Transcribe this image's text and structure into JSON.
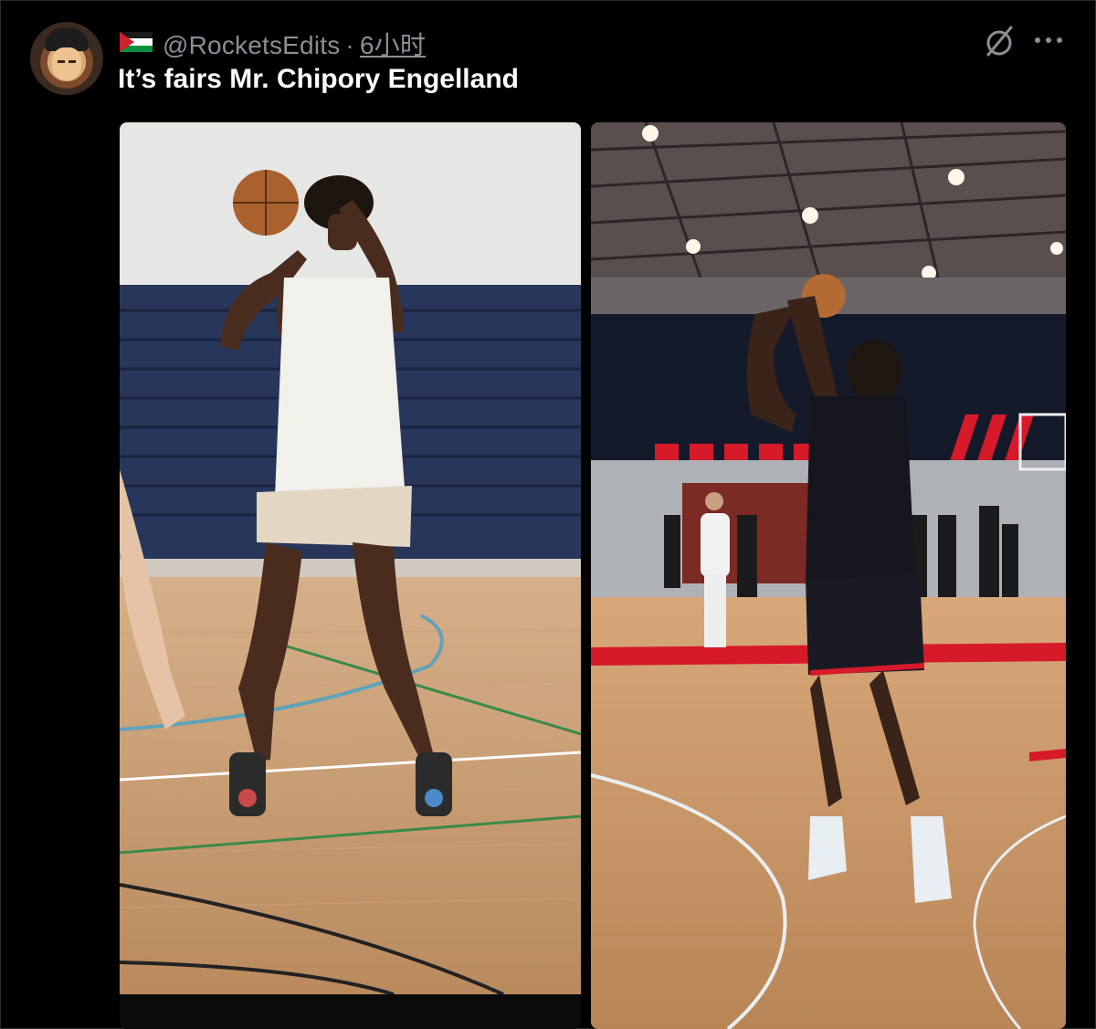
{
  "post": {
    "flag_label": "Palestine flag",
    "handle": "@RocketsEdits",
    "separator": "·",
    "time": "6小时",
    "text": "It’s fairs Mr. Chipory Engelland"
  },
  "icons": {
    "avatar": "avatar-icon",
    "mute": "mute-icon",
    "more": "more-icon"
  },
  "colors": {
    "background": "#000000",
    "text_primary": "#ffffff",
    "text_secondary": "#8b8f94",
    "court_wood": "#c99a66",
    "rockets_red": "#d71a2a"
  }
}
